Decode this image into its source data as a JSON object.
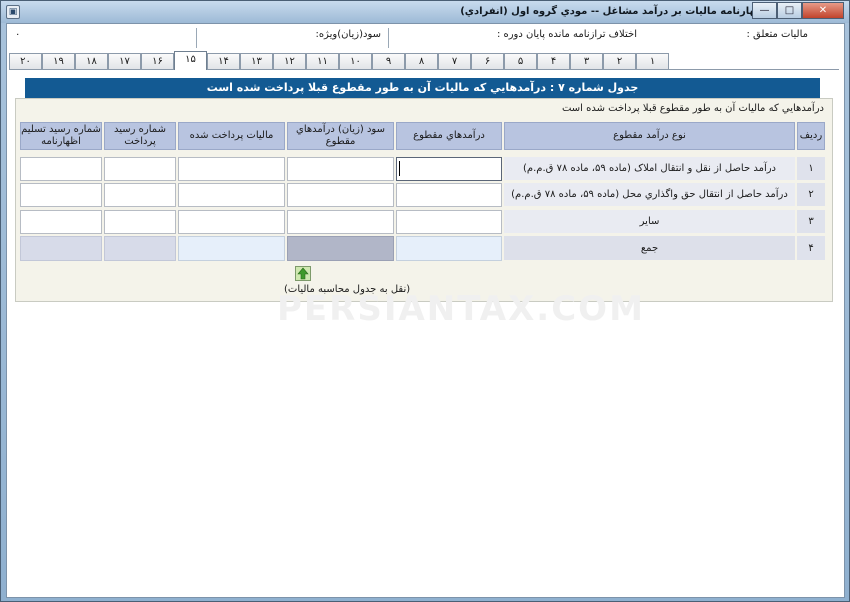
{
  "window": {
    "title": "اظهارنامه ماليات بر درآمد مشاغل -- مودي گروه اول (انفرادي)",
    "buttons": {
      "minimize": "—",
      "maximize": "□",
      "close": "✕"
    }
  },
  "info": {
    "taxable": "ماليات متعلق :",
    "taxable_value": "۰",
    "profit": "سود(زيان)ويژه:",
    "balance_diff": "اختلاف ترازنامه مانده پايان دوره :"
  },
  "tabs": [
    "۱",
    "۲",
    "۳",
    "۴",
    "۵",
    "۶",
    "۷",
    "۸",
    "۹",
    "۱۰",
    "۱۱",
    "۱۲",
    "۱۳",
    "۱۴",
    "۱۵",
    "۱۶",
    "۱۷",
    "۱۸",
    "۱۹",
    "۲۰"
  ],
  "active_tab": "۱۵",
  "form": {
    "heading": "جدول شماره ۷ : درآمدهايي که ماليات آن به طور مقطوع قبلا پرداخت شده است",
    "subline": "درآمدهايي که ماليات آن به طور مقطوع قبلا پرداخت شده است",
    "columns": {
      "row": "رديف",
      "type": "نوع درآمد مقطوع",
      "income": "درآمدهاي مقطوع",
      "profit": "سود (زيان) درآمدهاي مقطوع",
      "tax_paid": "ماليات پرداخت شده",
      "receipt": "شماره رسيد پرداخت",
      "filing_receipt": "شماره رسيد تسليم اظهارنامه"
    },
    "rows": [
      {
        "num": "۱",
        "label": "درآمد حاصل از نقل و انتقال املاک (ماده ۵۹، ماده ۷۸ ق.م.م)"
      },
      {
        "num": "۲",
        "label": "درآمد حاصل از انتقال حق واگذاري محل (ماده ۵۹، ماده ۷۸ ق.م.م)"
      },
      {
        "num": "۳",
        "label": "ساير"
      },
      {
        "num": "۴",
        "label": "جمع"
      }
    ],
    "transfer_label": "(نقل به جدول محاسبه ماليات)"
  },
  "watermark": "PERSIANTAX.COM",
  "icons": {
    "system": "window-icon",
    "transfer": "up-arrow-icon"
  }
}
